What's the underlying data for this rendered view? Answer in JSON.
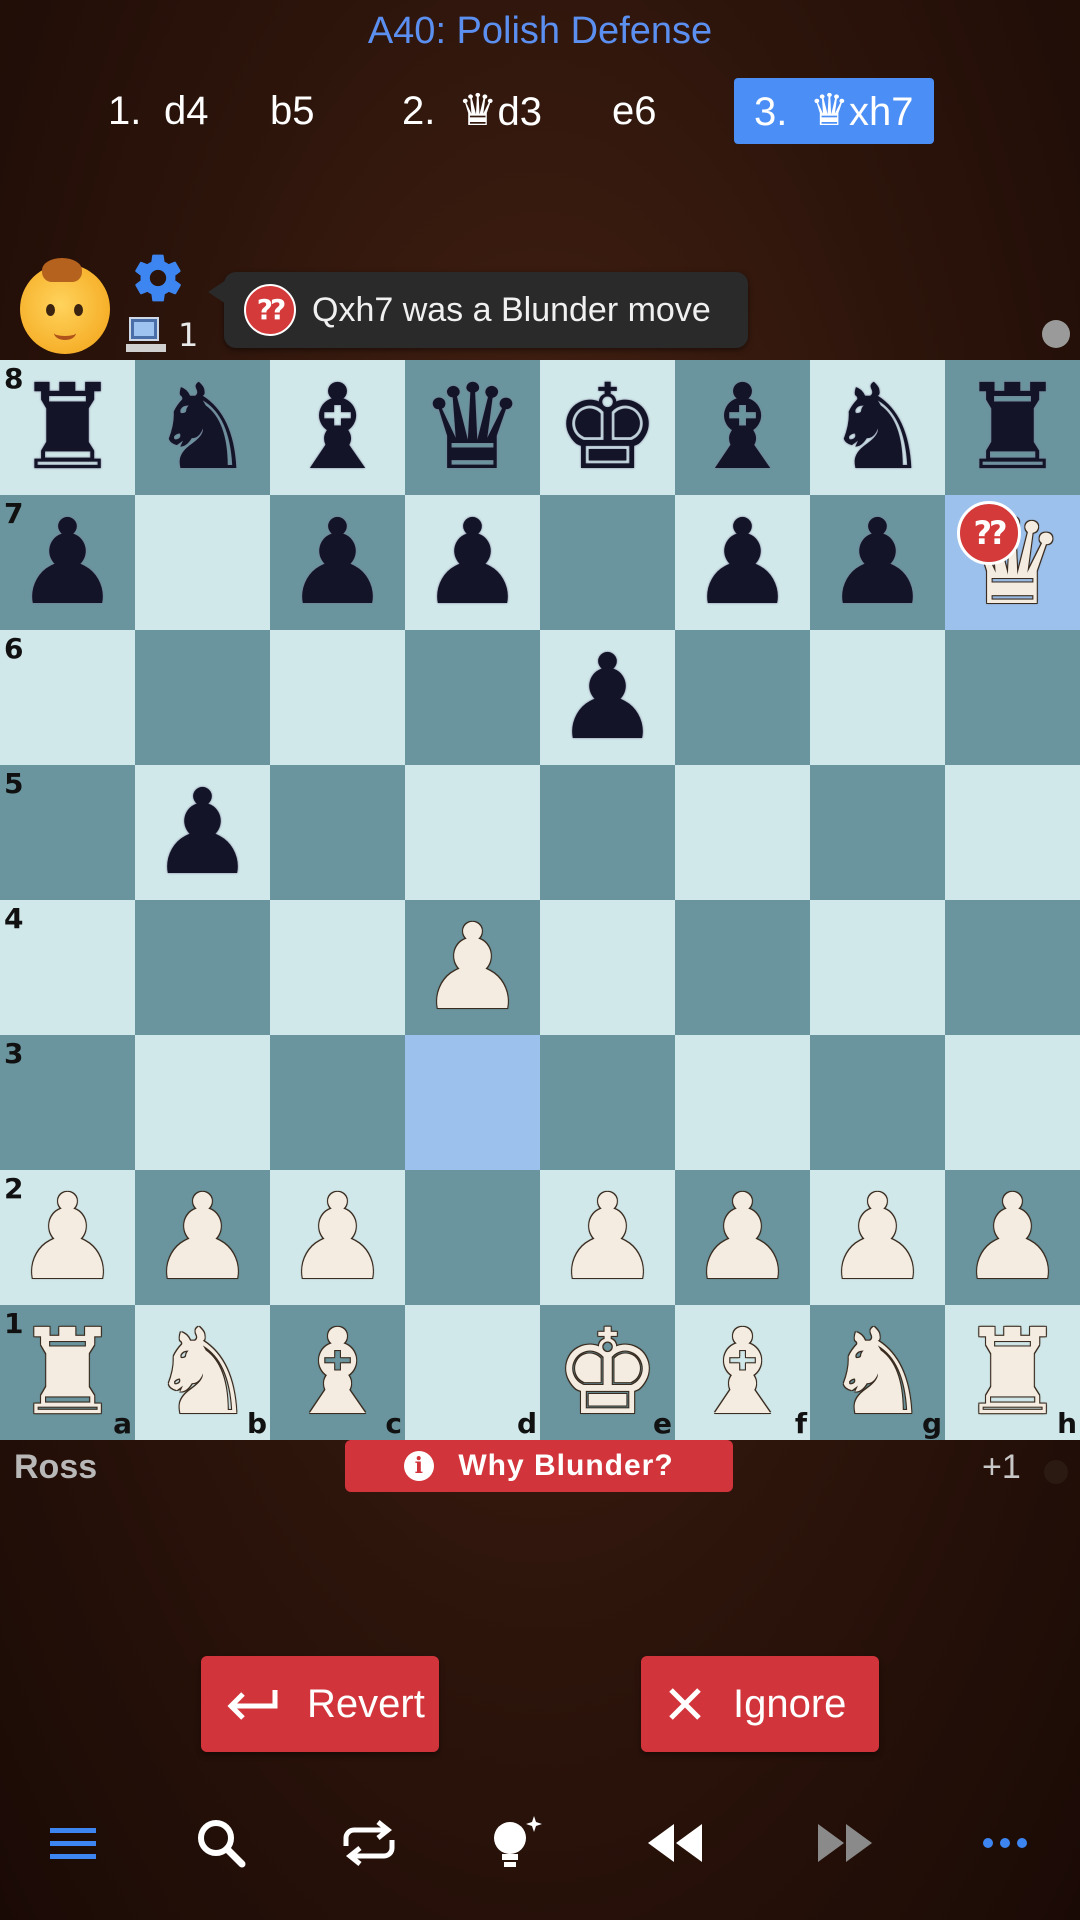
{
  "header": {
    "opening": "A40: Polish Defense",
    "moves": [
      {
        "num": "1.",
        "white": "d4",
        "black": "b5"
      },
      {
        "num": "2.",
        "white_piece": "♛",
        "white": "d3",
        "black": "e6"
      },
      {
        "num": "3.",
        "white_piece": "♛",
        "white": "xh7",
        "active": true
      }
    ]
  },
  "opponent": {
    "avatar": "baby-face",
    "level": "1",
    "message_badge": "??",
    "message": "Qxh7 was a Blunder move"
  },
  "board": {
    "ranks": [
      "8",
      "7",
      "6",
      "5",
      "4",
      "3",
      "2",
      "1"
    ],
    "files": [
      "a",
      "b",
      "c",
      "d",
      "e",
      "f",
      "g",
      "h"
    ],
    "highlight_from": "d3",
    "highlight_to": "h7",
    "blunder_square": "h7",
    "blunder_badge": "??",
    "light_color": "#d1e8ea",
    "dark_color": "#6a959e",
    "highlight_color": "#9cc1ec"
  },
  "player": {
    "name": "Ross",
    "score": "+1"
  },
  "why_button": {
    "icon": "i",
    "label": "Why Blunder?"
  },
  "actions": {
    "revert_label": "Revert",
    "ignore_label": "Ignore"
  },
  "toolbar": {
    "icons": [
      "menu-icon",
      "search-icon",
      "flip-icon",
      "hint-icon",
      "rewind-icon",
      "fast-forward-icon",
      "more-icon"
    ]
  },
  "colors": {
    "accent": "#4b8ef5",
    "danger": "#d1343a"
  }
}
